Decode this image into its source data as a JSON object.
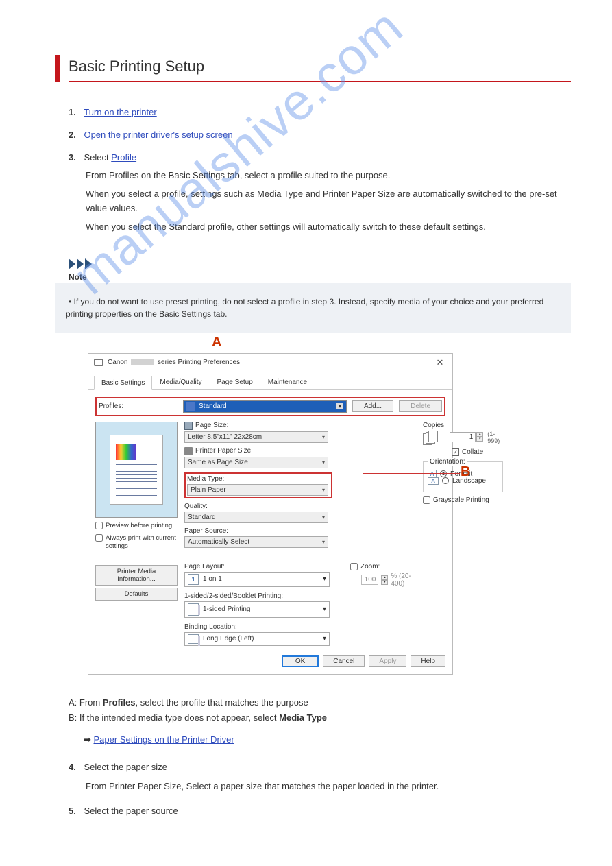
{
  "page_title": "Basic Printing Setup",
  "watermark": "manualshive.com",
  "step1": {
    "num": "1.",
    "link_text": "Turn on the printer"
  },
  "step2": {
    "num": "2.",
    "link_text": "Open the printer driver's setup screen"
  },
  "step3": {
    "num": "3.",
    "text_before": "Select ",
    "link_text": "Profile",
    "substep": "From Profiles on the Basic Settings tab, select a profile suited to the purpose.",
    "sub2": "When you select a profile, settings such as Media Type and Printer Paper Size are automatically switched to the pre-set value values.",
    "sub3": "When you select the Standard profile, other settings will automatically switch to these default settings."
  },
  "note": {
    "label": "Note",
    "bullet": "• ",
    "text": "If you do not want to use preset printing, do not select a profile in step 3. Instead, specify media of your choice and your preferred printing properties on the Basic Settings tab."
  },
  "callouts": {
    "a": "A",
    "b": "B"
  },
  "dialog": {
    "title_pre": "Canon",
    "title_post": "series Printing Preferences",
    "tabs": [
      "Basic Settings",
      "Media/Quality",
      "Page Setup",
      "Maintenance"
    ],
    "profiles_label": "Profiles:",
    "profiles_value": "Standard",
    "add_btn": "Add...",
    "delete_btn": "Delete",
    "preview_chk": "Preview before printing",
    "always_chk": "Always print with current settings",
    "page_size_label": "Page Size:",
    "page_size_value": "Letter 8.5\"x11\" 22x28cm",
    "printer_size_label": "Printer Paper Size:",
    "printer_size_value": "Same as Page Size",
    "media_label": "Media Type:",
    "media_value": "Plain Paper",
    "quality_label": "Quality:",
    "quality_value": "Standard",
    "source_label": "Paper Source:",
    "source_value": "Automatically Select",
    "copies_label": "Copies:",
    "copies_value": "1",
    "copies_range": "(1-999)",
    "collate": "Collate",
    "orientation_label": "Orientation:",
    "portrait": "Portrait",
    "landscape": "Landscape",
    "gray": "Grayscale Printing",
    "layout_label": "Page Layout:",
    "layout_value": "1 on 1",
    "zoom_label": "Zoom:",
    "zoom_value": "100",
    "zoom_range": "% (20-400)",
    "sided_label": "1-sided/2-sided/Booklet Printing:",
    "sided_value": "1-sided Printing",
    "binding_label": "Binding Location:",
    "binding_value": "Long Edge (Left)",
    "media_info_btn": "Printer Media Information...",
    "defaults_btn": "Defaults",
    "ok": "OK",
    "cancel": "Cancel",
    "apply": "Apply",
    "help": "Help"
  },
  "after": {
    "line1_a": "A: From ",
    "line1_b": "Profiles",
    "line1_c": ", select the profile that matches the purpose",
    "line2_a": "B: If the intended media type does not appear, select ",
    "line2_b": "Media Type",
    "link4": "Paper Settings on the Printer Driver",
    "step4": {
      "num": "4.",
      "text": "Select the paper size",
      "sub": "From Printer Paper Size, Select a paper size that matches the paper loaded in the printer."
    },
    "step5": {
      "num": "5.",
      "text": "Select the paper source"
    }
  }
}
